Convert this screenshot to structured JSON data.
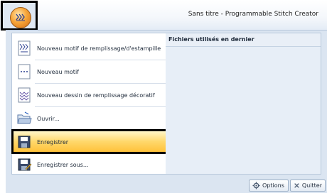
{
  "window": {
    "title": "Sans titre - Programmable Stitch Creator"
  },
  "menu": {
    "items": [
      {
        "label": "Nouveau motif de remplissage/d'estampille",
        "icon": "new-fill-pattern-icon"
      },
      {
        "label": "Nouveau motif",
        "icon": "new-motif-icon"
      },
      {
        "label": "Nouveau dessin de remplissage décoratif",
        "icon": "new-decorative-fill-icon"
      },
      {
        "label": "Ouvrir...",
        "icon": "open-folder-icon"
      },
      {
        "label": "Enregistrer",
        "icon": "save-disk-icon"
      },
      {
        "label": "Enregistrer sous...",
        "icon": "save-as-icon"
      }
    ],
    "recent_header": "Fichiers utilisés en dernier"
  },
  "footer": {
    "options_label": "Options",
    "quit_label": "Quitter"
  },
  "colors": {
    "highlight": "#ffd86b",
    "pane": "#e7eef7",
    "accent": "#f7a63a"
  }
}
